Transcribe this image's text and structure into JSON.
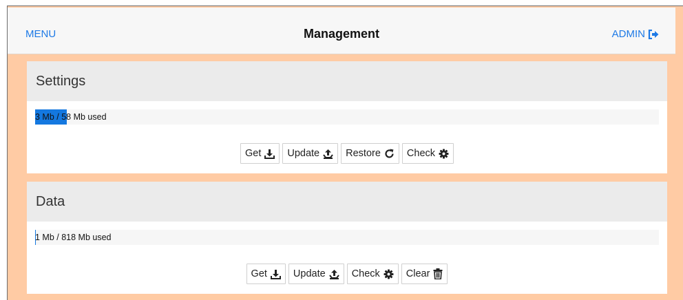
{
  "header": {
    "menu_label": "MENU",
    "title": "Management",
    "user_label": "ADMIN",
    "user_icon": "sign-out-icon"
  },
  "colors": {
    "accent": "#1e7ae6",
    "background": "#ffcba4",
    "progress": "#1478e0"
  },
  "sections": [
    {
      "title": "Settings",
      "usage_text": "3 Mb / 58 Mb used",
      "usage_fraction": 0.052,
      "buttons": [
        {
          "label": "Get",
          "icon": "download-icon"
        },
        {
          "label": "Update",
          "icon": "upload-tray-icon"
        },
        {
          "label": "Restore",
          "icon": "refresh-icon"
        },
        {
          "label": "Check",
          "icon": "gear-icon"
        }
      ]
    },
    {
      "title": "Data",
      "usage_text": "1 Mb / 818 Mb used",
      "usage_fraction": 0.001,
      "buttons": [
        {
          "label": "Get",
          "icon": "download-icon"
        },
        {
          "label": "Update",
          "icon": "upload-tray-icon"
        },
        {
          "label": "Check",
          "icon": "gear-icon"
        },
        {
          "label": "Clear",
          "icon": "trash-icon"
        }
      ]
    }
  ]
}
